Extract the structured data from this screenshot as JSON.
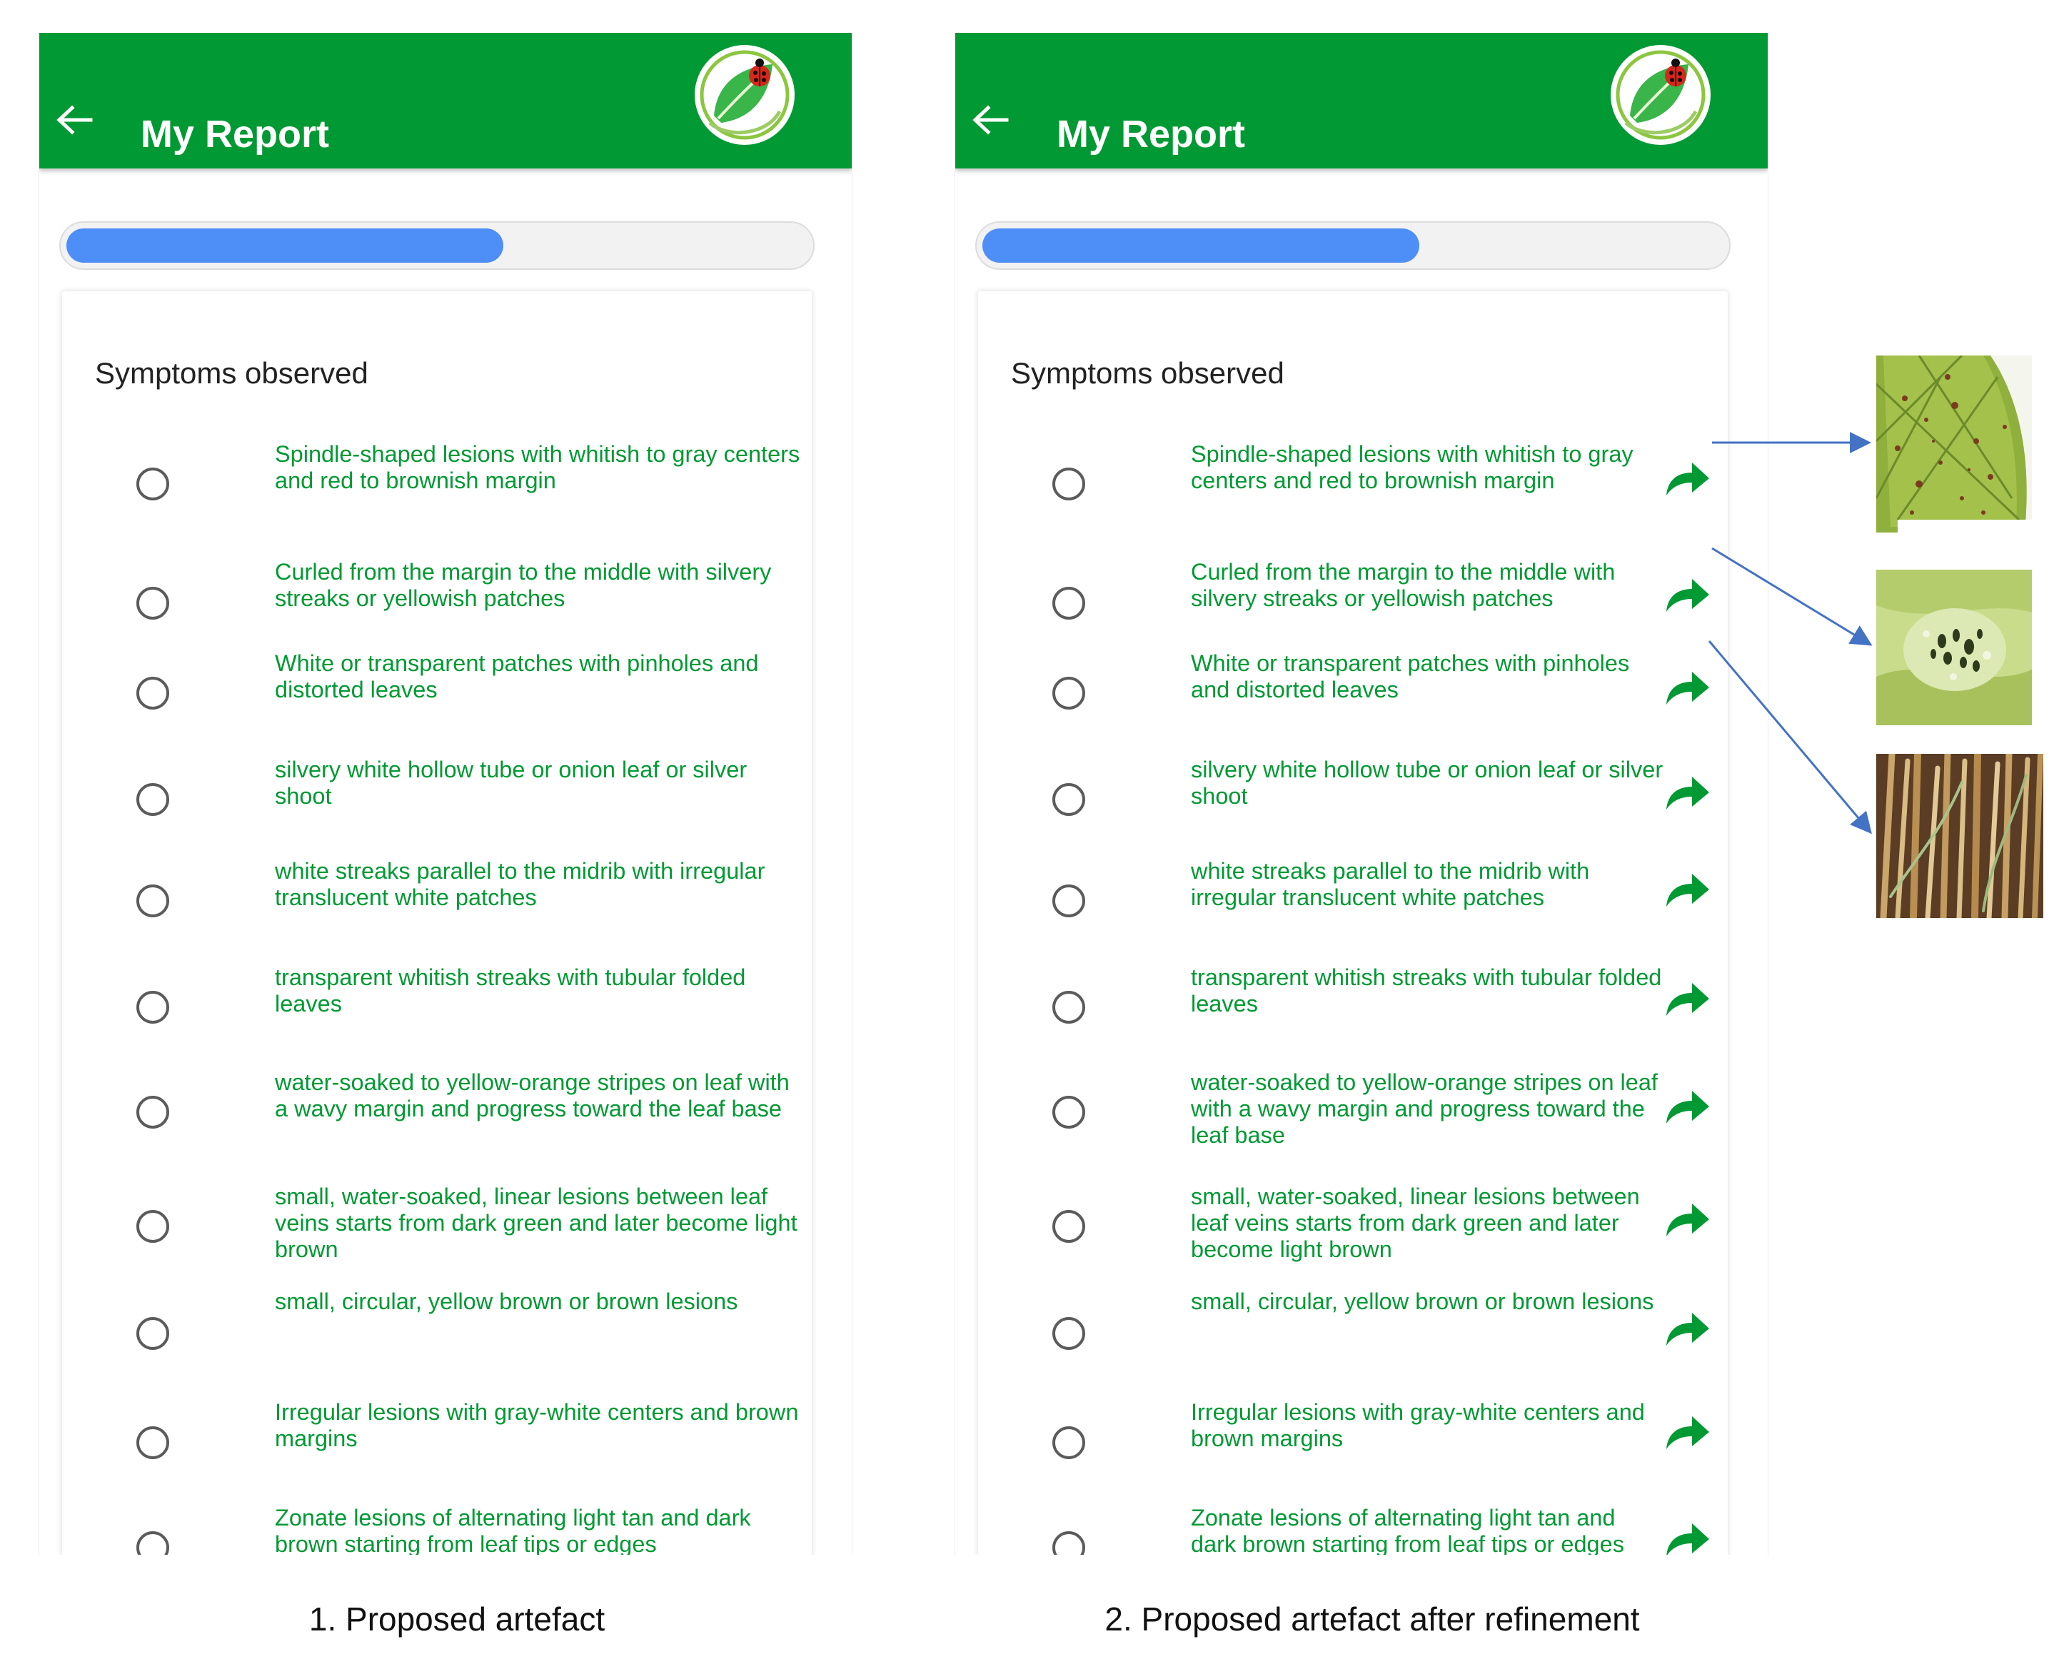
{
  "colors": {
    "appbar": "#009933",
    "item_text": "#009933",
    "progress_fill": "#4d8ef7",
    "annotation_arrow": "#4472c4"
  },
  "panels": [
    {
      "app_title": "My Report",
      "progress_fraction": 0.59,
      "section_title": "Symptoms observed",
      "show_share_icons": false,
      "caption": "1. Proposed artefact"
    },
    {
      "app_title": "My Report",
      "progress_fraction": 0.59,
      "section_title": "Symptoms observed",
      "show_share_icons": true,
      "caption": "2. Proposed artefact after refinement"
    }
  ],
  "symptoms": [
    "Spindle-shaped lesions with whitish to gray centers and red to brownish margin",
    "Curled from the margin to the middle with silvery streaks or yellowish patches",
    "White or transparent patches with pinholes and distorted leaves",
    "silvery white hollow tube or onion leaf or silver shoot",
    "white streaks parallel to the midrib with irregular translucent white patches",
    "transparent whitish streaks with tubular folded leaves",
    "water-soaked to yellow-orange stripes on leaf with a wavy margin and progress toward the leaf base",
    "small, water-soaked, linear lesions between leaf veins starts from dark green and later become light brown",
    "small, circular, yellow brown or brown lesions",
    "Irregular lesions with gray-white centers and brown margins",
    "Zonate lesions of alternating light tan and dark brown starting from leaf tips or edges"
  ],
  "icons": {
    "back": "arrow-left-icon",
    "logo": "ladybug-leaf-logo",
    "share": "share-arrow-icon",
    "radio": "radio-unchecked-icon"
  }
}
